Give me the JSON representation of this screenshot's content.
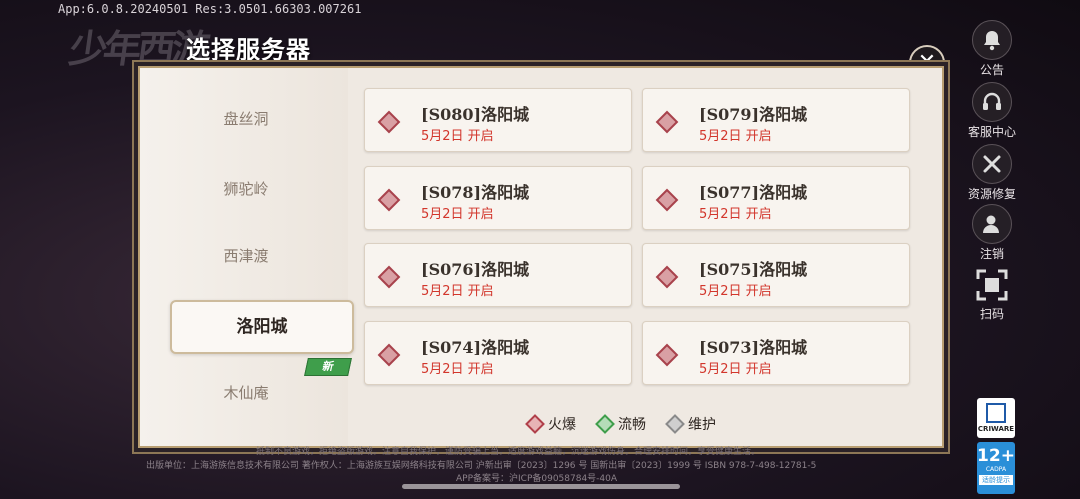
{
  "version_info": "App:6.0.8.20240501  Res:3.0501.66303.007261",
  "logo_text": "少年西游",
  "dialog": {
    "title": "选择服务器",
    "close_label": "✕"
  },
  "nav": {
    "items": [
      {
        "label": "盘丝洞"
      },
      {
        "label": "狮驼岭"
      },
      {
        "label": "西津渡"
      },
      {
        "label": "洛阳城"
      },
      {
        "label": "木仙庵"
      }
    ],
    "active_index": 3,
    "new_badge": "新"
  },
  "servers": [
    {
      "name": "[S080]洛阳城",
      "date": "5月2日 开启",
      "status": "火爆"
    },
    {
      "name": "[S079]洛阳城",
      "date": "5月2日 开启",
      "status": "火爆"
    },
    {
      "name": "[S078]洛阳城",
      "date": "5月2日 开启",
      "status": "火爆"
    },
    {
      "name": "[S077]洛阳城",
      "date": "5月2日 开启",
      "status": "火爆"
    },
    {
      "name": "[S076]洛阳城",
      "date": "5月2日 开启",
      "status": "火爆"
    },
    {
      "name": "[S075]洛阳城",
      "date": "5月2日 开启",
      "status": "火爆"
    },
    {
      "name": "[S074]洛阳城",
      "date": "5月2日 开启",
      "status": "火爆"
    },
    {
      "name": "[S073]洛阳城",
      "date": "5月2日 开启",
      "status": "火爆"
    }
  ],
  "legend": [
    {
      "label": "火爆",
      "color": "#b0404a"
    },
    {
      "label": "流畅",
      "color": "#3f9e4b"
    },
    {
      "label": "维护",
      "color": "#8a8a8a"
    }
  ],
  "side_buttons": [
    {
      "label": "公告",
      "icon": "bell-icon"
    },
    {
      "label": "客服中心",
      "icon": "headset-icon"
    },
    {
      "label": "资源修复",
      "icon": "wrench-icon"
    },
    {
      "label": "注销",
      "icon": "user-logout-icon"
    },
    {
      "label": "扫码",
      "icon": "scan-icon"
    }
  ],
  "footer": {
    "line1": "抵制不良游戏，拒绝盗版游戏。注意自我保护，谨防受骗上当。适度游戏益脑，沉迷游戏伤身。合理安排时间，享受健康生活。",
    "line2": "出版单位：上海游族信息技术有限公司  著作权人：上海游族互娱网络科技有限公司  沪新出审〔2023〕1296 号  国新出审〔2023〕1999 号  ISBN 978-7-498-12781-5",
    "line3": "APP备案号：沪ICP备09058784号-40A"
  },
  "badges": {
    "criware": "CRIWARE",
    "age_rating": "12+",
    "age_org": "CADPA",
    "age_tip": "适龄提示"
  }
}
